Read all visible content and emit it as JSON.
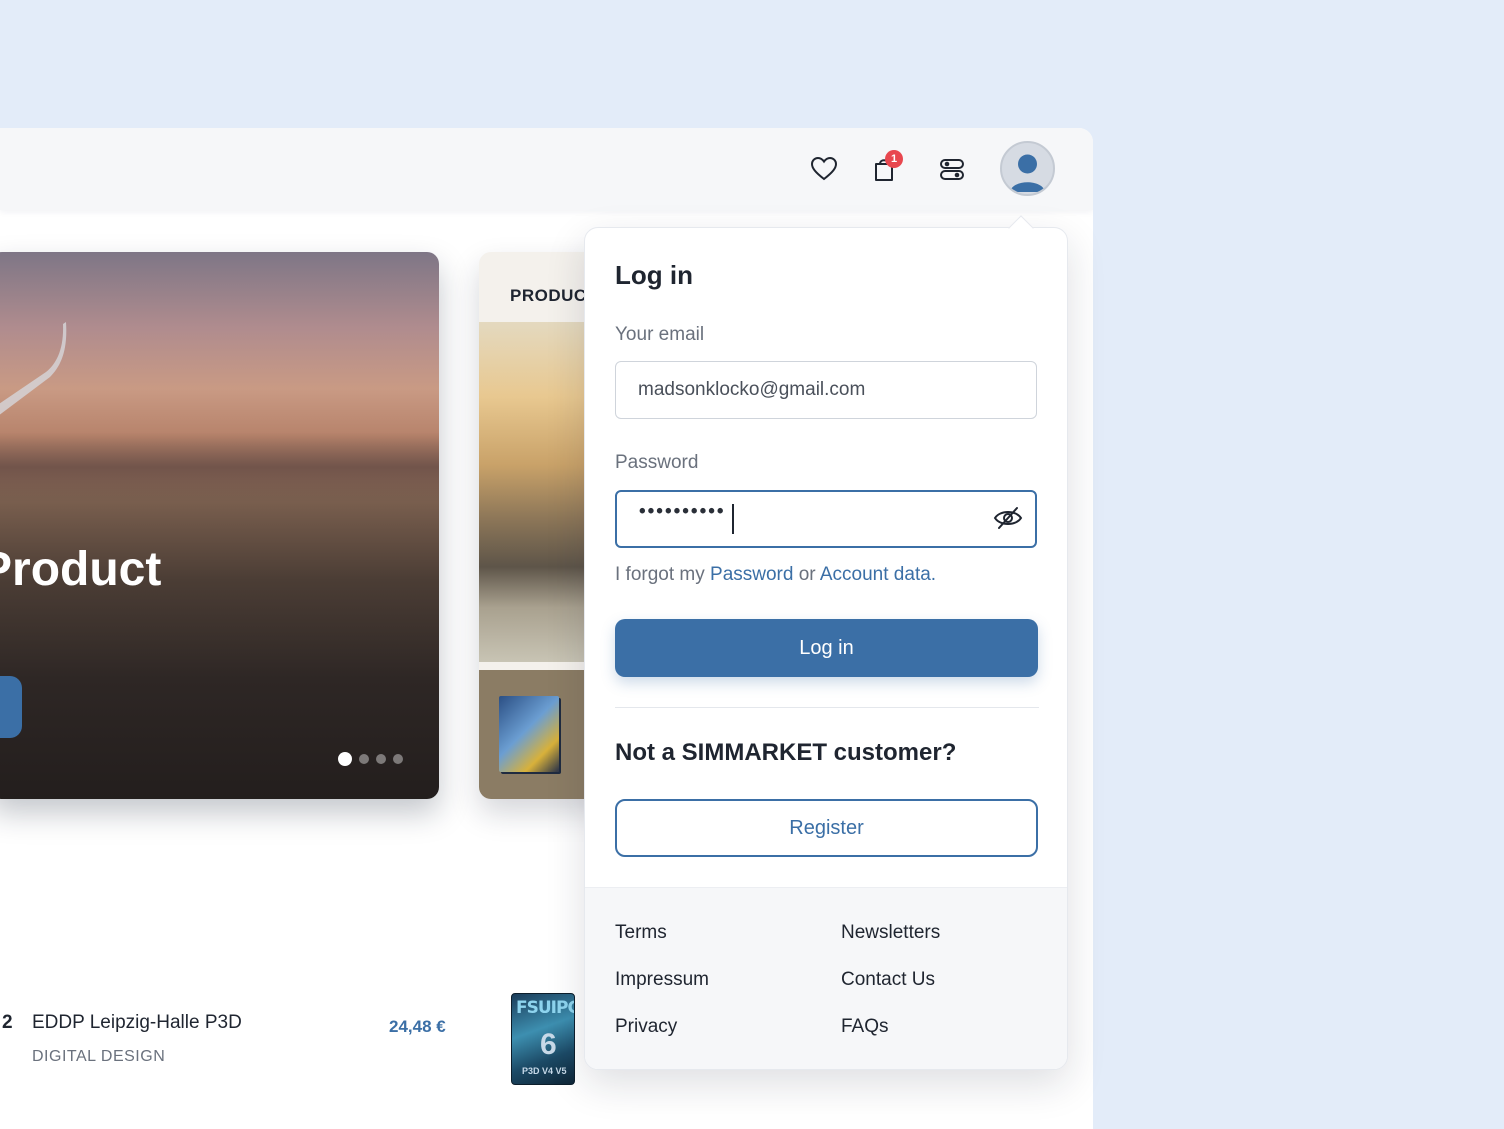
{
  "header": {
    "cart_count": "1",
    "icons": [
      "heart-icon",
      "cart-icon",
      "settings-toggle-icon",
      "user-icon"
    ]
  },
  "hero": {
    "title": "Product",
    "slides_total": 4,
    "active_slide": 1
  },
  "card2": {
    "label": "PRODUC"
  },
  "list_row": {
    "number": "2",
    "title": "EDDP Leipzig-Halle P3D",
    "subtitle": "DIGITAL DESIGN",
    "price": "24,48 €",
    "thumb_text": "FSUIPC",
    "thumb_number": "6",
    "thumb_sub": "P3D V4 V5"
  },
  "login": {
    "title": "Log in",
    "email_label": "Your email",
    "email_value": "madsonklocko@gmail.com",
    "password_label": "Password",
    "password_masked": "••••••••••",
    "forgot_prefix": "I forgot my",
    "forgot_password_link": "Password",
    "forgot_or": "or",
    "forgot_account_link": "Account data",
    "forgot_suffix": ".",
    "submit_label": "Log in",
    "register_prompt": "Not a SIMMARKET customer?",
    "register_label": "Register"
  },
  "footer_links": {
    "terms": "Terms",
    "impressum": "Impressum",
    "privacy": "Privacy",
    "newsletters": "Newsletters",
    "contact": "Contact Us",
    "faqs": "FAQs"
  },
  "colors": {
    "accent": "#3b6fa6",
    "badge": "#e8474f",
    "background": "#e3ecf9"
  }
}
